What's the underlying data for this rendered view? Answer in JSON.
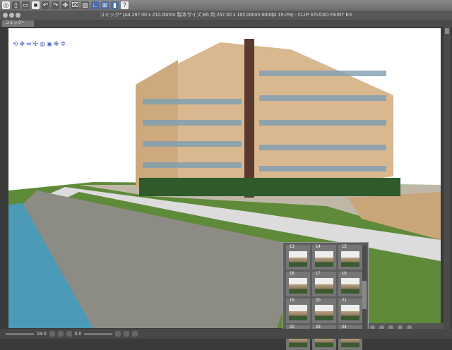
{
  "window": {
    "title": "コミック* (A4 297.00 x 210.00mm 製本サイズ:B5 判 257.00 x 182.00mm 600dpi 19.0%)  - CLIP STUDIO PAINT EX"
  },
  "tab": {
    "label": "コミック*"
  },
  "toolbar": {
    "icons": [
      "app-menu",
      "new",
      "open",
      "save",
      "undo",
      "redo",
      "transform",
      "clear",
      "fill",
      "snap-ruler",
      "snap-grid",
      "special-ruler",
      "help"
    ]
  },
  "status": {
    "zoom": "19.0",
    "angle": "0.0"
  },
  "thumbnails": {
    "items": [
      "13",
      "14",
      "15",
      "16",
      "17",
      "18",
      "19",
      "20",
      "21",
      "22",
      "23",
      "24"
    ]
  }
}
